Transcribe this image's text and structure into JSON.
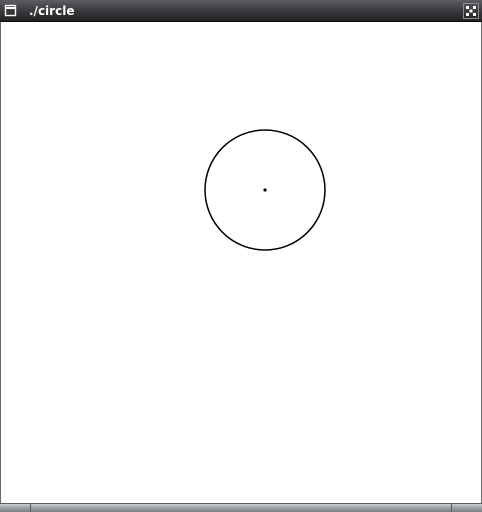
{
  "window": {
    "title": "./circle",
    "icons": {
      "menu": "window-menu-icon",
      "maximize": "maximize-icon"
    },
    "colors": {
      "titlebar": "#3c3e41",
      "title_text": "#ffffff",
      "canvas": "#ffffff",
      "stroke": "#000000"
    }
  },
  "canvas": {
    "shapes": [
      "circle",
      "center-dot"
    ]
  }
}
